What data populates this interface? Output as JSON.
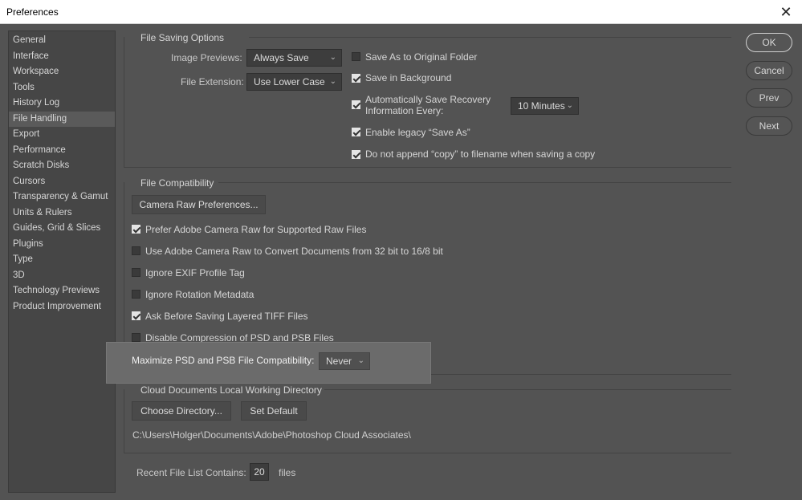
{
  "window": {
    "title": "Preferences",
    "close_symbol": "✕"
  },
  "sidebar": {
    "items": [
      {
        "label": "General"
      },
      {
        "label": "Interface"
      },
      {
        "label": "Workspace"
      },
      {
        "label": "Tools"
      },
      {
        "label": "History Log"
      },
      {
        "label": "File Handling",
        "active": true
      },
      {
        "label": "Export"
      },
      {
        "label": "Performance"
      },
      {
        "label": "Scratch Disks"
      },
      {
        "label": "Cursors"
      },
      {
        "label": "Transparency & Gamut"
      },
      {
        "label": "Units & Rulers"
      },
      {
        "label": "Guides, Grid & Slices"
      },
      {
        "label": "Plugins"
      },
      {
        "label": "Type"
      },
      {
        "label": "3D"
      },
      {
        "label": "Technology Previews"
      },
      {
        "label": "Product Improvement"
      }
    ]
  },
  "buttons": {
    "ok": "OK",
    "cancel": "Cancel",
    "prev": "Prev",
    "next": "Next"
  },
  "file_saving": {
    "header": "File Saving Options",
    "image_previews_label": "Image Previews:",
    "image_previews_value": "Always Save",
    "file_extension_label": "File Extension:",
    "file_extension_value": "Use Lower Case",
    "save_as_original": {
      "label": "Save As to Original Folder",
      "checked": false
    },
    "save_in_background": {
      "label": "Save in Background",
      "checked": true
    },
    "auto_save": {
      "label_line1": "Automatically Save Recovery",
      "label_line2": "Information Every:",
      "checked": true
    },
    "auto_save_interval": "10 Minutes",
    "legacy_save_as": {
      "label": "Enable legacy “Save As”",
      "checked": true
    },
    "no_copy_suffix": {
      "label": "Do not append “copy” to filename when saving a copy",
      "checked": true
    }
  },
  "file_compat": {
    "header": "File Compatibility",
    "camera_raw_prefs_button": "Camera Raw Preferences...",
    "options": [
      {
        "label": "Prefer Adobe Camera Raw for Supported Raw Files",
        "checked": true
      },
      {
        "label": "Use Adobe Camera Raw to Convert Documents from 32 bit to 16/8 bit",
        "checked": false
      },
      {
        "label": "Ignore EXIF Profile Tag",
        "checked": false
      },
      {
        "label": "Ignore Rotation Metadata",
        "checked": false
      },
      {
        "label": "Ask Before Saving Layered TIFF Files",
        "checked": true
      },
      {
        "label": "Disable Compression of PSD and PSB Files",
        "checked": false
      }
    ],
    "maximize_label": "Maximize PSD and PSB File Compatibility:",
    "maximize_value": "Never"
  },
  "cloud": {
    "header": "Cloud Documents Local Working Directory",
    "choose_dir_button": "Choose Directory...",
    "set_default_button": "Set Default",
    "path": "C:\\Users\\Holger\\Documents\\Adobe\\Photoshop Cloud Associates\\"
  },
  "recent": {
    "label": "Recent File List Contains:",
    "value": "20",
    "suffix": "files"
  },
  "icons": {
    "chevron": "⌄"
  }
}
